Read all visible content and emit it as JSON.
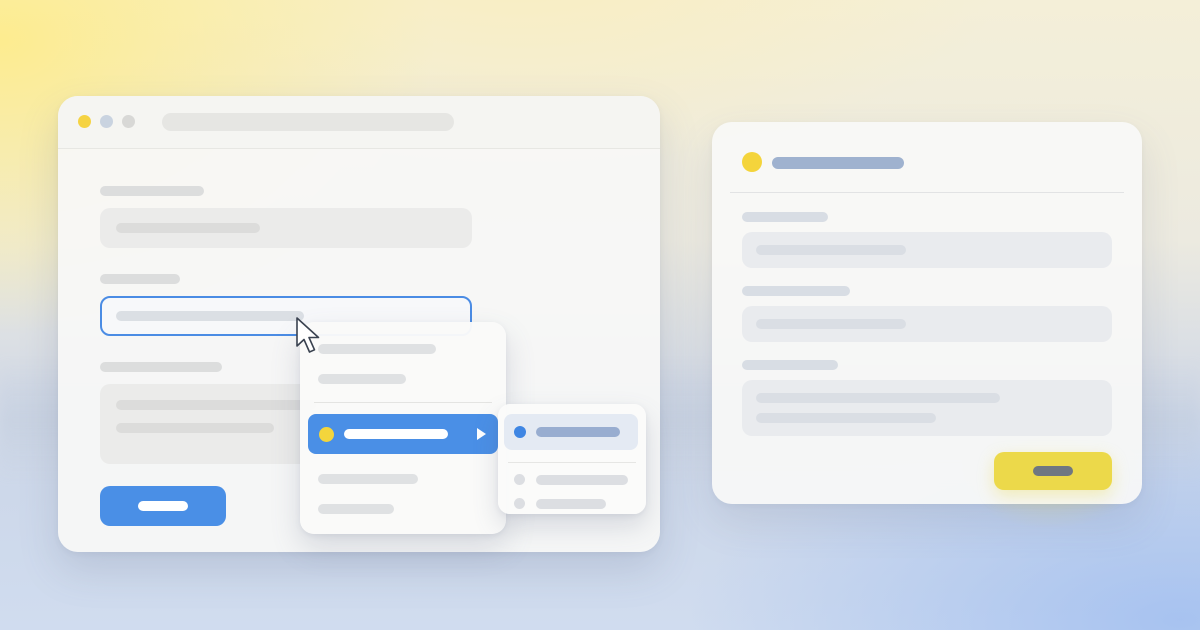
{
  "illustration": {
    "type": "abstract-ui-mockup",
    "text_content": "none",
    "accent_colors": {
      "primary_blue": "#4a8fe6",
      "highlight_yellow": "#f4d43b",
      "muted_blue": "#9fb2cf",
      "placeholder_gray": "#dcdcdb"
    }
  },
  "browser_window": {
    "traffic_lights": [
      "yellow",
      "blue-gray",
      "gray"
    ],
    "form": {
      "fields": [
        {
          "state": "default"
        },
        {
          "state": "focused"
        },
        {
          "state": "default",
          "multiline": true
        }
      ],
      "submit_button": {
        "color": "#4a8fe6"
      }
    }
  },
  "dropdown_menu": {
    "items": [
      {
        "state": "default"
      },
      {
        "state": "default"
      },
      {
        "state": "selected",
        "has_submenu": true,
        "icon": "yellow-dot-icon"
      },
      {
        "state": "default"
      },
      {
        "state": "default"
      }
    ]
  },
  "submenu": {
    "items": [
      {
        "state": "selected",
        "icon": "blue-dot-icon"
      },
      {
        "state": "default"
      },
      {
        "state": "default"
      }
    ]
  },
  "cursor": {
    "icon": "arrow-cursor-icon"
  },
  "side_card": {
    "header_icon": "yellow-dot-icon",
    "fields": [
      {
        "multiline": false
      },
      {
        "multiline": false
      },
      {
        "multiline": true
      }
    ],
    "button": {
      "color": "#ecd94a"
    }
  }
}
